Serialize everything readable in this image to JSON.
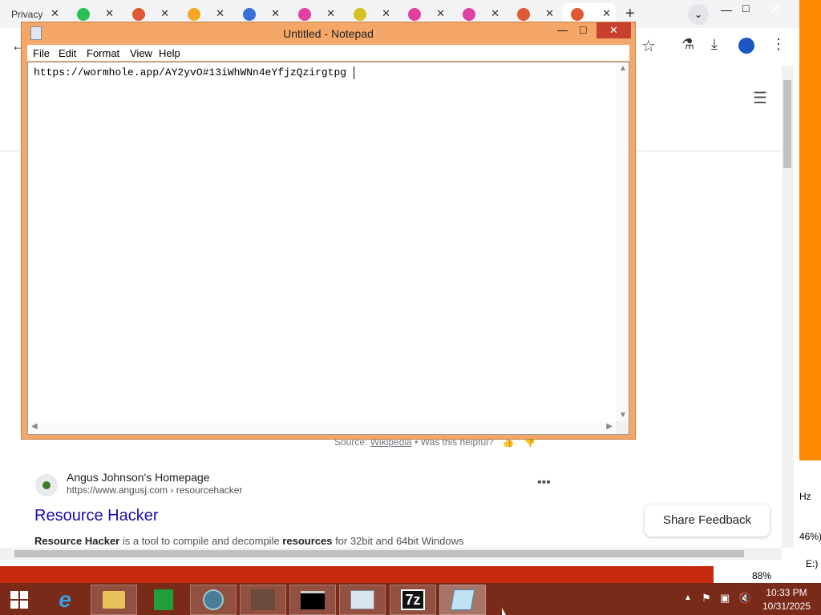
{
  "browser": {
    "tabs": [
      {
        "label": "Privacy",
        "color": "#4a7bd9"
      },
      {
        "label": "",
        "color": "#2bbf55"
      },
      {
        "label": "",
        "color": "#de5833"
      },
      {
        "label": "",
        "color": "#f5a623"
      },
      {
        "label": "",
        "color": "#3a6fd8"
      },
      {
        "label": "",
        "color": "#e040a0"
      },
      {
        "label": "",
        "color": "#d4c020"
      },
      {
        "label": "",
        "color": "#e040a0"
      },
      {
        "label": "",
        "color": "#e040a0"
      },
      {
        "label": "",
        "color": "#de5833"
      },
      {
        "label": "",
        "color": "#de5833",
        "active": true
      }
    ],
    "new_tab_icon": "plus-icon",
    "toolbar_icons": [
      "star-icon",
      "labs-flask-icon",
      "download-icon",
      "profile-icon",
      "menu-kebab-icon"
    ]
  },
  "web_page": {
    "source_prefix": "Source: ",
    "source_link": "Wikipedia",
    "source_suffix": " • Was this helpful?",
    "result": {
      "site_name": "Angus Johnson's Homepage",
      "site_url": "https://www.angusj.com › resourcehacker",
      "title": "Resource Hacker",
      "snippet_bold1": "Resource Hacker",
      "snippet_mid": " is a tool to compile and decompile ",
      "snippet_bold2": "resources",
      "snippet_end": " for 32bit and 64bit Windows"
    },
    "share_feedback": "Share Feedback",
    "side_partial": {
      "hz": "Hz",
      "pct": "46%)",
      "drive": "E:)"
    }
  },
  "notepad": {
    "title": "Untitled - Notepad",
    "menu": [
      "File",
      "Edit",
      "Format",
      "View",
      "Help"
    ],
    "content": "https://wormhole.app/AY2yvO#13iWhWNn4eYfjzQzirgtpg"
  },
  "taskbar": {
    "apps": [
      "start-windows-icon",
      "internet-explorer-icon",
      "file-explorer-icon",
      "store-icon",
      "browser-globe-icon",
      "photo-app-icon",
      "cmd-icon",
      "task-manager-icon",
      "7zip-icon",
      "notepad-icon"
    ],
    "zip_label": "7z",
    "battery_pct": "88%",
    "time": "10:33 PM",
    "date": "10/31/2025"
  }
}
